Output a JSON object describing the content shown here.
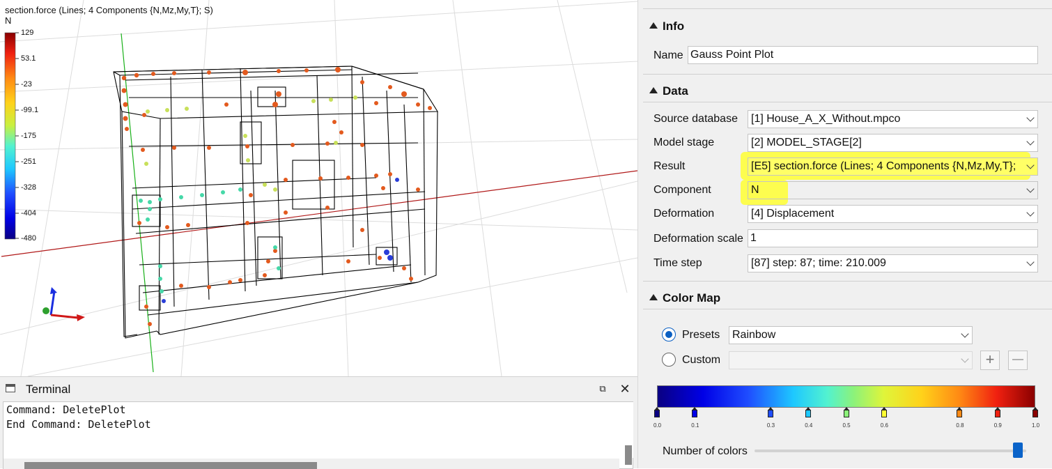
{
  "viewport": {
    "plot_title": "section.force (Lines; 4 Components {N,Mz,My,T}; S)",
    "plot_unit": "N",
    "colorbar_ticks": [
      "129",
      "53.1",
      "-23",
      "-99.1",
      "-175",
      "-251",
      "-328",
      "-404",
      "-480"
    ]
  },
  "terminal": {
    "title": "Terminal",
    "float_glyph": "⧉",
    "close_glyph": "✕",
    "lines": [
      "Command: DeletePlot",
      "End Command: DeletePlot"
    ]
  },
  "editor": {
    "info": {
      "header": "Info",
      "name_label": "Name",
      "name_value": "Gauss Point Plot"
    },
    "data": {
      "header": "Data",
      "source_label": "Source database",
      "source_value": "[1] House_A_X_Without.mpco",
      "stage_label": "Model stage",
      "stage_value": "[2] MODEL_STAGE[2]",
      "result_label": "Result",
      "result_value": "[E5] section.force (Lines; 4 Components {N,Mz,My,T}; S)",
      "component_label": "Component",
      "component_value": "N",
      "deformation_label": "Deformation",
      "deformation_value": "[4] Displacement",
      "scale_label": "Deformation scale",
      "scale_value": "1",
      "timestep_label": "Time step",
      "timestep_value": "[87] step: 87; time: 210.009"
    },
    "colormap": {
      "header": "Color Map",
      "presets_label": "Presets",
      "presets_value": "Rainbow",
      "presets_selected": true,
      "custom_label": "Custom",
      "custom_value": "",
      "add_glyph": "+",
      "remove_glyph": "—",
      "stops": [
        "0.0",
        "0.1",
        "0.3",
        "0.4",
        "0.5",
        "0.6",
        "0.8",
        "0.9",
        "1.0"
      ],
      "stop_colors": [
        "#0a0082",
        "#0000e6",
        "#1f4dff",
        "#1ec8ff",
        "#8cf27a",
        "#ffff33",
        "#ff8a14",
        "#f02010",
        "#8a0000"
      ],
      "number_of_colors_label": "Number of colors",
      "number_of_colors_fraction": 0.97
    }
  }
}
